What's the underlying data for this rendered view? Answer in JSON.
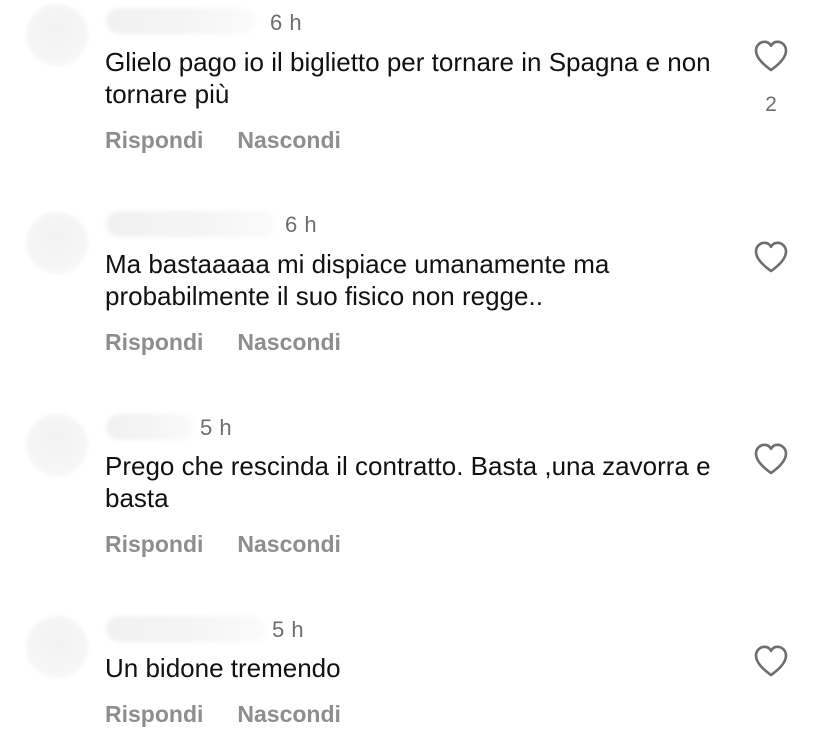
{
  "comments": [
    {
      "time": "6 h",
      "text": "Glielo pago io il biglietto per tornare in Spagna e non tornare più",
      "like_count": "2",
      "reply_label": "Rispondi",
      "hide_label": "Nascondi"
    },
    {
      "time": "6 h",
      "text": "Ma bastaaaaa mi dispiace umanamente ma probabilmente il suo fisico non regge..",
      "reply_label": "Rispondi",
      "hide_label": "Nascondi"
    },
    {
      "time": "5 h",
      "text": "Prego che rescinda il contratto. Basta ,una zavorra e basta",
      "reply_label": "Rispondi",
      "hide_label": "Nascondi"
    },
    {
      "time": "5 h",
      "text": "Un bidone tremendo",
      "reply_label": "Rispondi",
      "hide_label": "Nascondi"
    }
  ],
  "icons": {
    "like": "heart-outline-icon"
  },
  "colors": {
    "text": "#111111",
    "muted": "#8e8e8e",
    "timestamp": "#6e6e6e",
    "background": "#ffffff"
  }
}
